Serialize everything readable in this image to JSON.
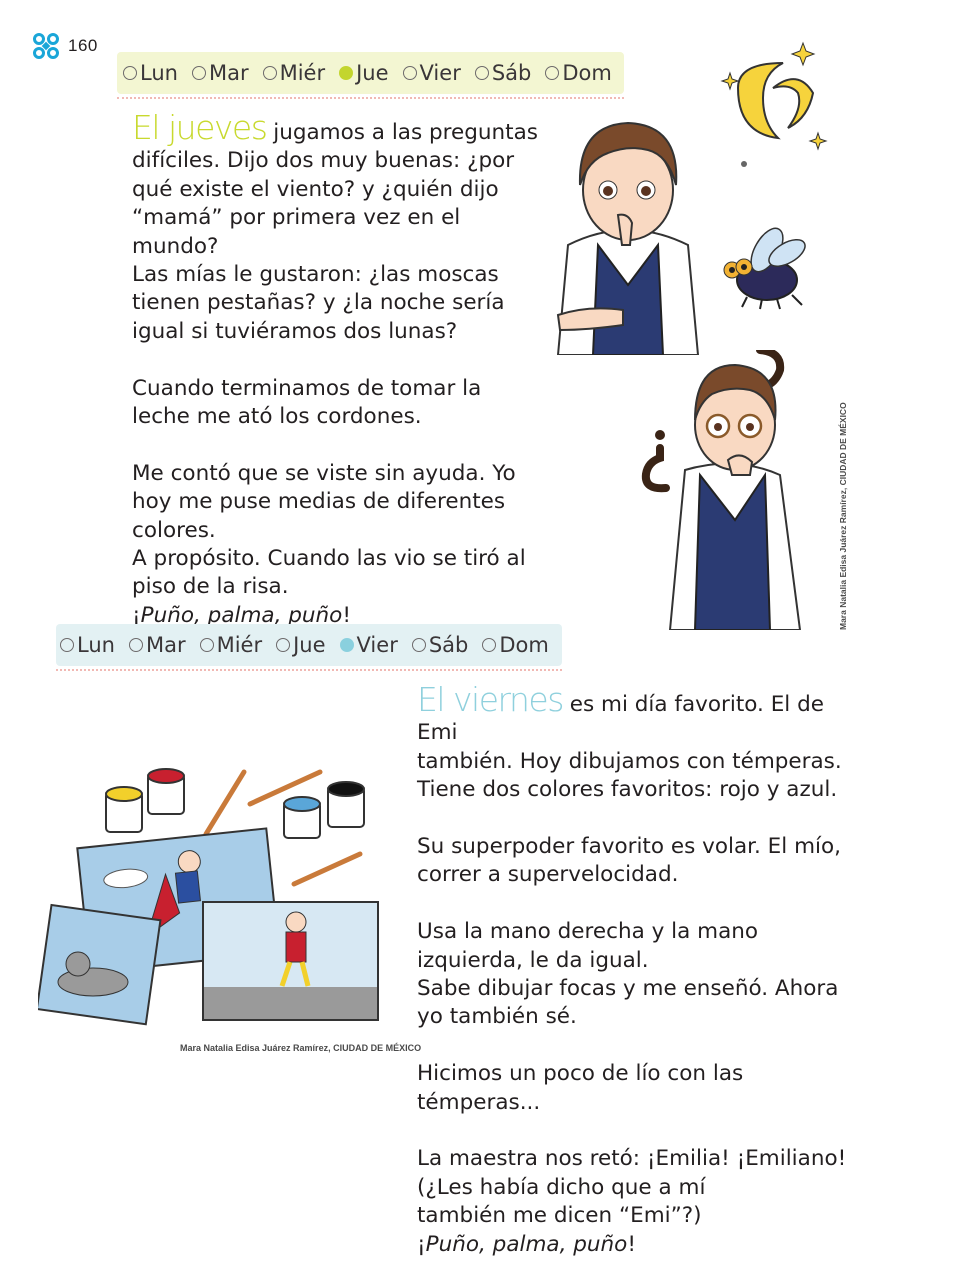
{
  "header": {
    "page_number": "160"
  },
  "day_bar_thursday": {
    "days": [
      "Lun",
      "Mar",
      "Miér",
      "Jue",
      "Vier",
      "Sáb",
      "Dom"
    ],
    "selected_index": 3,
    "selected_color": "#c3d52e"
  },
  "day_bar_friday": {
    "days": [
      "Lun",
      "Mar",
      "Miér",
      "Jue",
      "Vier",
      "Sáb",
      "Dom"
    ],
    "selected_index": 4,
    "selected_color": "#8ad0de"
  },
  "thursday": {
    "lead": "El jueves",
    "lines": [
      " jugamos a las preguntas",
      "difíciles. Dijo dos muy buenas: ¿por",
      "qué existe el viento? y ¿quién dijo",
      "“mamá” por primera vez en el mundo?",
      "Las mías le gustaron: ¿las moscas",
      "tienen pestañas? y ¿la noche sería",
      "igual si tuviéramos dos lunas?"
    ],
    "para2": [
      "Cuando terminamos de tomar la",
      "leche me ató los cordones."
    ],
    "para3": [
      "Me contó que se viste sin ayuda. Yo",
      "hoy me puse medias de diferentes",
      "colores.",
      "A propósito. Cuando las vio se tiró al",
      "piso de la risa."
    ],
    "refrain_open": "¡",
    "refrain_text": "Puño, palma, puño",
    "refrain_close": "!"
  },
  "friday": {
    "lead": "El viernes",
    "lines": [
      " es mi día favorito. El de Emi",
      "también. Hoy dibujamos con témperas.",
      "Tiene dos colores favoritos: rojo y azul."
    ],
    "para2": [
      "Su superpoder favorito es volar. El mío,",
      "correr a supervelocidad."
    ],
    "para3": [
      "Usa la mano derecha y la mano",
      "izquierda, le da igual.",
      "Sabe dibujar focas y me enseñó. Ahora",
      "yo también sé."
    ],
    "para4": [
      "Hicimos un poco de lío con las",
      "témperas..."
    ],
    "para5": [
      "La maestra nos retó: ¡Emilia! ¡Emiliano!",
      "(¿Les había dicho que a mí",
      "también me dicen “Emi”?)"
    ],
    "refrain_open": "¡",
    "refrain_text": "Puño, palma, puño",
    "refrain_close": "!"
  },
  "credits": {
    "vertical": "Mara Natalia Edisa Juárez Ramírez, CIUDAD DE MÉXICO",
    "horizontal": "Mara Natalia Edisa Juárez Ramírez, CIUDAD DE MÉXICO"
  },
  "colors": {
    "thursday_accent": "#c8d92e",
    "friday_accent": "#8fd0dd",
    "header_logo": "#1aa6d8"
  }
}
